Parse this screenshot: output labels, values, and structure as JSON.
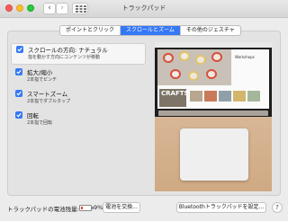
{
  "window": {
    "title": "トラックパッド"
  },
  "tabs": [
    {
      "label": "ポイントとクリック"
    },
    {
      "label": "スクロールとズーム"
    },
    {
      "label": "その他のジェスチャ"
    }
  ],
  "options": [
    {
      "title": "スクロールの方向: ナチュラル",
      "subtitle": "指を動かす方向にコンテンツが移動",
      "checked": true
    },
    {
      "title": "拡大/縮小",
      "subtitle": "2本指でピンチ",
      "checked": true
    },
    {
      "title": "スマートズーム",
      "subtitle": "2本指でダブルタップ",
      "checked": true
    },
    {
      "title": "回転",
      "subtitle": "2本指で回転",
      "checked": true
    }
  ],
  "preview": {
    "page_heading": "Workshops",
    "crafts_label": "CRAFTS"
  },
  "footer": {
    "battery_label": "トラックパッドの電池残量:",
    "battery_percent": "9%",
    "battery_level": 0.09,
    "change_battery_button": "電池を交換...",
    "setup_button": "Bluetoothトラックパッドを設定...",
    "help_button": "?"
  },
  "colors": {
    "accent": "#3478f6",
    "battery_low": "#e0443e"
  }
}
